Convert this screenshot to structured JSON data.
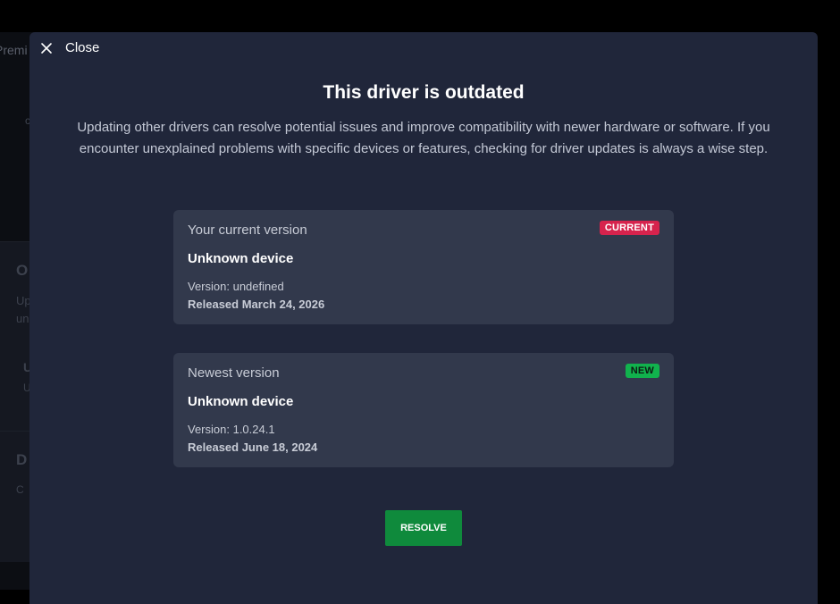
{
  "background": {
    "title_fragment": "Premi",
    "letter_c": "c",
    "card_one": {
      "heading_letter": "O",
      "line1": "Up",
      "line2": "un",
      "row_letter": "U",
      "row_sub": "U"
    },
    "card_two": {
      "heading_letter": "D",
      "sub": "C"
    }
  },
  "modal": {
    "close": {
      "icon": "close-icon",
      "label": "Close"
    },
    "title": "This driver is outdated",
    "description": "Updating other drivers can resolve potential issues and improve compatibility with newer hardware or software. If you encounter unexplained problems with specific devices or features, checking for driver updates is always a wise step.",
    "current": {
      "heading": "Your current version",
      "badge": "CURRENT",
      "badge_color": "#d6234d",
      "device": "Unknown device",
      "version": "Version: undefined",
      "released": "Released March 24, 2026"
    },
    "newest": {
      "heading": "Newest version",
      "badge": "NEW",
      "badge_color": "#11b24d",
      "device": "Unknown device",
      "version": "Version: 1.0.24.1",
      "released": "Released June 18, 2024"
    },
    "resolve_label": "RESOLVE",
    "accent_color": "#0f8a3c"
  }
}
